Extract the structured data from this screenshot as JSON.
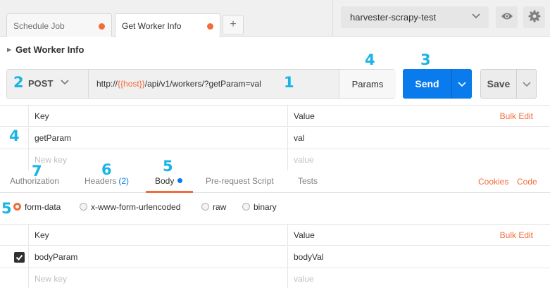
{
  "tabs": [
    {
      "label": "Schedule Job",
      "unsaved": true
    },
    {
      "label": "Get Worker Info",
      "unsaved": true,
      "active": true
    }
  ],
  "new_tab_label": "+",
  "environment": {
    "selected": "harvester-scrapy-test"
  },
  "header_icons": [
    "eye-icon",
    "gear-icon"
  ],
  "request": {
    "name": "Get Worker Info",
    "method": "POST",
    "url_prefix": "http://",
    "url_var": "{{host}}",
    "url_suffix": "/api/v1/workers/?getParam=val",
    "params_label": "Params",
    "send_label": "Send",
    "save_label": "Save"
  },
  "query_params": {
    "key_header": "Key",
    "value_header": "Value",
    "bulk_edit": "Bulk Edit",
    "rows": [
      {
        "key": "getParam",
        "value": "val"
      }
    ],
    "new_key_placeholder": "New key",
    "new_value_placeholder": "value"
  },
  "subtabs": {
    "authorization": "Authorization",
    "headers": "Headers",
    "headers_count": "(2)",
    "body": "Body",
    "prerequest": "Pre-request Script",
    "tests": "Tests",
    "cookies": "Cookies",
    "code": "Code"
  },
  "body_modes": {
    "form_data": "form-data",
    "urlencoded": "x-www-form-urlencoded",
    "raw": "raw",
    "binary": "binary",
    "selected": "form-data"
  },
  "body_params": {
    "key_header": "Key",
    "value_header": "Value",
    "bulk_edit": "Bulk Edit",
    "rows": [
      {
        "key": "bodyParam",
        "value": "bodyVal",
        "checked": true
      }
    ],
    "new_key_placeholder": "New key",
    "new_value_placeholder": "value"
  },
  "annotations": {
    "url": "1",
    "method": "2",
    "send": "3",
    "params_button": "4",
    "params_table": "4",
    "body_tab": "5",
    "body_mode": "5",
    "headers_tab": "6",
    "auth_tab": "7"
  },
  "colors": {
    "accent": "#f26b3a",
    "send": "#097bed",
    "annotation": "#19b4e6"
  }
}
